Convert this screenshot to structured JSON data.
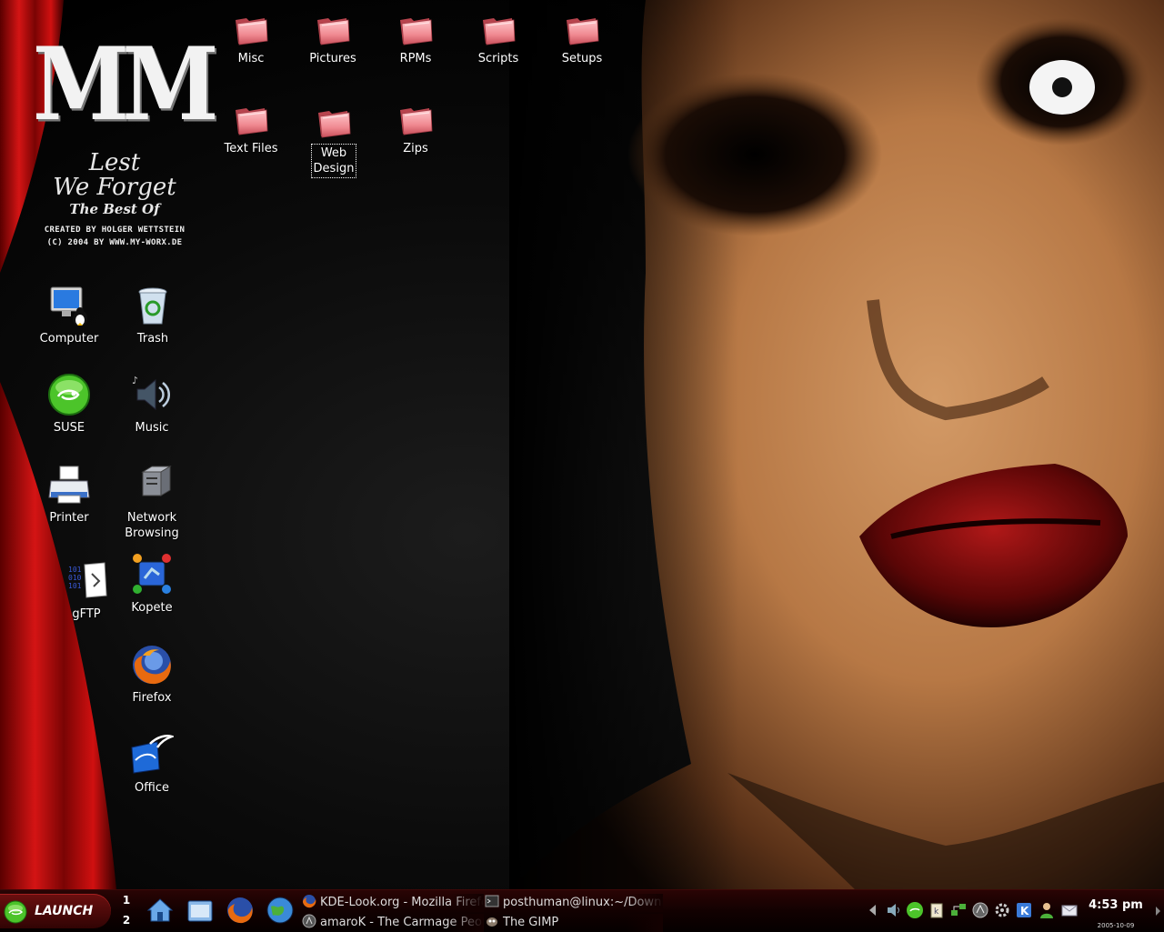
{
  "wallpaper": {
    "logo_mark": "MM",
    "logo_title_1": "Lest",
    "logo_title_2": "We Forget",
    "logo_subtitle": "The Best Of",
    "credit_line_1": "CREATED BY HOLGER WETTSTEIN",
    "credit_line_2": "(C) 2004 BY WWW.MY-WORX.DE"
  },
  "desktop": {
    "folders": [
      {
        "label": "Misc"
      },
      {
        "label": "Pictures"
      },
      {
        "label": "RPMs"
      },
      {
        "label": "Scripts"
      },
      {
        "label": "Setups"
      },
      {
        "label": "Text Files"
      },
      {
        "label": "Web\nDesign"
      },
      {
        "label": "Zips"
      }
    ],
    "icons": [
      {
        "label": "Computer",
        "icon": "computer-icon"
      },
      {
        "label": "Trash",
        "icon": "trash-icon"
      },
      {
        "label": "SUSE",
        "icon": "suse-icon"
      },
      {
        "label": "Music",
        "icon": "music-icon"
      },
      {
        "label": "Printer",
        "icon": "printer-icon"
      },
      {
        "label": "Network\nBrowsing",
        "icon": "network-icon"
      },
      {
        "label": "gFTP",
        "icon": "gftp-icon"
      },
      {
        "label": "Kopete",
        "icon": "kopete-icon"
      },
      {
        "label": "Firefox",
        "icon": "firefox-icon"
      },
      {
        "label": "Office",
        "icon": "office-icon"
      }
    ]
  },
  "taskbar": {
    "launch_label": "LAUNCH",
    "pager": [
      "1",
      "2"
    ],
    "quick_launch": [
      "home-icon",
      "file-manager-icon",
      "firefox-icon",
      "browser-globe-icon"
    ],
    "tasks": [
      {
        "label": "KDE-Look.org - Mozilla Firefox",
        "icon": "firefox-icon"
      },
      {
        "label": "posthuman@linux:~/Downloads",
        "icon": "terminal-icon"
      },
      {
        "label": "amaroK - The Carmage People",
        "icon": "amarok-icon"
      },
      {
        "label": "The GIMP",
        "icon": "gimp-icon"
      }
    ],
    "tray": [
      "arrow-left-icon",
      "volume-icon",
      "suse-updater-icon",
      "klipper-icon",
      "network-icon",
      "amarok-tray-icon",
      "settings-icon",
      "kde-icon",
      "kopete-tray-icon",
      "mail-icon"
    ],
    "clock_time": "4:53 pm",
    "clock_date": "2005-10-09"
  },
  "colors": {
    "folder": "#f08a92",
    "taskbar": "#1a0202",
    "launch": "#5a0a0a",
    "curtain": "#c41212",
    "skin": "#c08050"
  }
}
